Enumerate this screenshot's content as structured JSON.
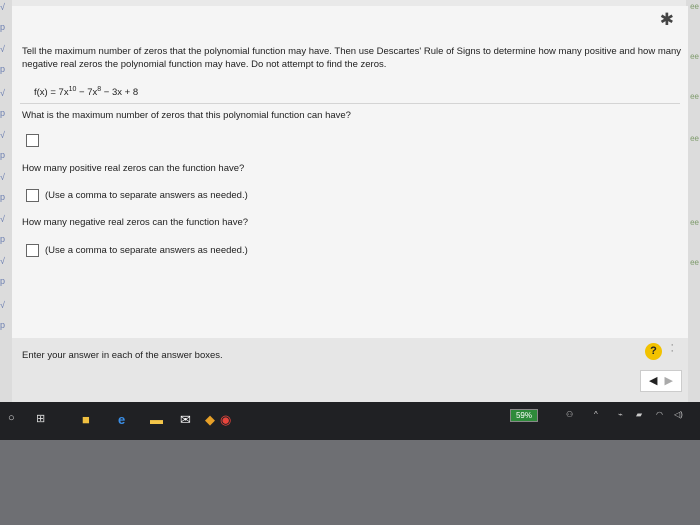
{
  "question": {
    "instructions": "Tell the maximum number of zeros that the polynomial function may have. Then use Descartes' Rule of Signs to determine how many positive and how many negative real zeros the polynomial function may have. Do not attempt to find the zeros.",
    "function_prefix": "f(x) = 7x",
    "exp1": "10",
    "mid": " − 7x",
    "exp2": "8",
    "suffix": " − 3x + 8",
    "q1": "What is the maximum number of zeros that this polynomial function can have?",
    "q2": "How many positive real zeros can the function have?",
    "q2_hint": "(Use a comma to separate answers as needed.)",
    "q3": "How many negative real zeros can the function have?",
    "q3_hint": "(Use a comma to separate answers as needed.)"
  },
  "footer": {
    "enter_text": "Enter your answer in each of the answer boxes.",
    "help_label": "?"
  },
  "taskbar": {
    "battery": "59%"
  },
  "icons": {
    "settings": "gear-icon",
    "prev": "arrow-left-icon",
    "next": "arrow-right-icon"
  }
}
